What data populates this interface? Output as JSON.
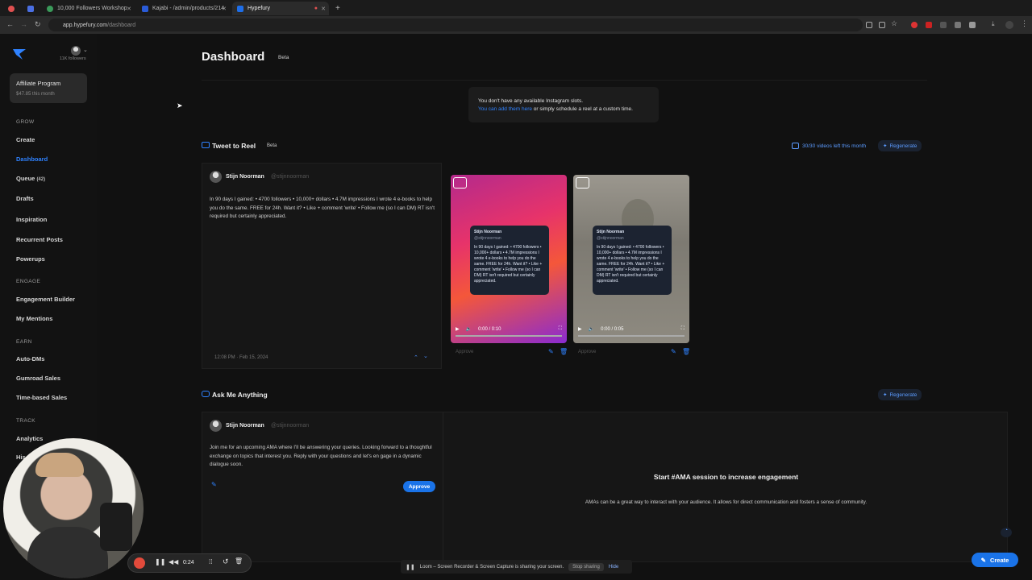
{
  "tabs": [
    {
      "title": "",
      "color": "#e05050"
    },
    {
      "title": "",
      "color": "#4a6fe3"
    },
    {
      "title": "10,000 Followers Workshop",
      "color": "#3a9a5a"
    },
    {
      "title": "Kajabi - /admin/products/214",
      "color": "#2a5bd7"
    },
    {
      "title": "Hypefury",
      "color": "#1e6ee8"
    }
  ],
  "url": {
    "host": "app.hypefury.com",
    "path": "/dashboard"
  },
  "sidebar": {
    "followers": "11K followers",
    "affiliate": {
      "title": "Affiliate Program",
      "amount": "$47.85 this month"
    },
    "sections": {
      "grow": "GROW",
      "engage": "ENGAGE",
      "earn": "EARN",
      "track": "TRACK"
    },
    "items": {
      "create": "Create",
      "dashboard": "Dashboard",
      "queue": "Queue",
      "queue_count": "(42)",
      "drafts": "Drafts",
      "inspiration": "Inspiration",
      "recurrent": "Recurrent Posts",
      "powerups": "Powerups",
      "engagement_builder": "Engagement Builder",
      "mentions": "My Mentions",
      "autodms": "Auto-DMs",
      "gumroad": "Gumroad Sales",
      "timebased": "Time-based Sales",
      "analytics": "Analytics",
      "history": "His"
    }
  },
  "header": {
    "title": "Dashboard",
    "badge": "Beta"
  },
  "notice": {
    "line1": "You don't have any available Instagram slots.",
    "link": "You can add them here",
    "line2": " or simply schedule a reel at a custom time."
  },
  "tweet_to_reel": {
    "title": "Tweet to Reel",
    "badge": "Beta",
    "quota": "30/30 videos left this month",
    "regenerate": "Regenerate",
    "author": "Stijn Noorman",
    "handle": "@stijnnoorman",
    "text": "In 90 days I gained: • 4700 followers • 10,000+ dollars • 4.7M impressions I wrote 4 e-books to help you do the same. FREE for 24h. Want it? • Like + comment 'write' • Follow me (so I can DM) RT isn't required but certainly appreciated.",
    "timestamp": "12:08 PM · Feb 15, 2024",
    "video1": {
      "time": "0:00 / 0:10",
      "approve": "Approve"
    },
    "video2": {
      "time": "0:00 / 0:05",
      "approve": "Approve"
    },
    "mini_text": "In 90 days I gained: • 4700 followers • 10,000+ dollars • 4.7M impressions I wrote 4 e-books to help you do the same. FREE for 24h. Want it? • Like + comment 'write' • Follow me (so I can DM) RT isn't required but certainly appreciated."
  },
  "ama": {
    "title": "Ask Me Anything",
    "regenerate": "Regenerate",
    "author": "Stijn Noorman",
    "handle": "@stijnnoorman",
    "text": "Join me for an upcoming AMA where I'll be answering your queries. Looking forward to a thoughtful exchange on topics that interest you. Reply with your questions and let's en gage in a dynamic dialogue soon.",
    "approve": "Approve",
    "cta_title": "Start #AMA session to increase engagement",
    "cta_text": "AMAs can be a great way to interact with your audience. It allows for direct communication and fosters a sense of community."
  },
  "create_button": "Create",
  "recorder": {
    "time": "0:24"
  },
  "share_bar": {
    "text": "Loom – Screen Recorder & Screen Capture is sharing your screen.",
    "stop": "Stop sharing",
    "hide": "Hide"
  }
}
